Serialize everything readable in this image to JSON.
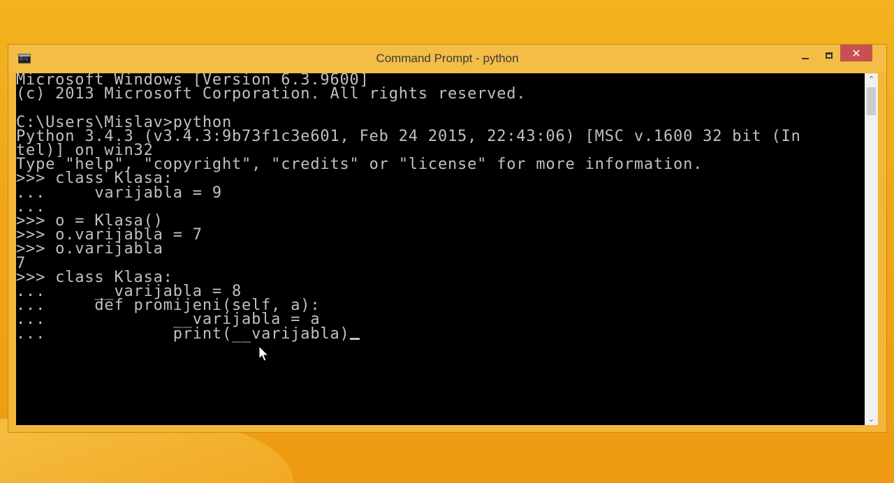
{
  "window": {
    "title": "Command Prompt - python",
    "close_glyph": "✕"
  },
  "icons": {
    "app": "command-prompt-icon",
    "minimize": "minimize-icon",
    "maximize": "maximize-icon",
    "close": "close-icon",
    "scroll_up": "chevron-up-icon",
    "scroll_down": "chevron-down-icon",
    "pointer": "mouse-pointer-icon"
  },
  "scrollbar": {
    "up_glyph": "⌃",
    "down_glyph": "⌄"
  },
  "console": {
    "lines": [
      "Microsoft Windows [Version 6.3.9600]",
      "(c) 2013 Microsoft Corporation. All rights reserved.",
      "",
      "C:\\Users\\Mislav>python",
      "Python 3.4.3 (v3.4.3:9b73f1c3e601, Feb 24 2015, 22:43:06) [MSC v.1600 32 bit (In",
      "tel)] on win32",
      "Type \"help\", \"copyright\", \"credits\" or \"license\" for more information.",
      ">>> class Klasa:",
      "...     varijabla = 9",
      "...",
      ">>> o = Klasa()",
      ">>> o.varijabla = 7",
      ">>> o.varijabla",
      "7",
      ">>> class Klasa:",
      "...     __varijabla = 8",
      "...     def promijeni(self, a):",
      "...             __varijabla = a",
      "...             print(__varijabla)"
    ]
  },
  "colors": {
    "console_bg": "#000000",
    "console_text": "#c0c0c0",
    "desktop": "#f0a818",
    "close_button": "#c75050"
  }
}
